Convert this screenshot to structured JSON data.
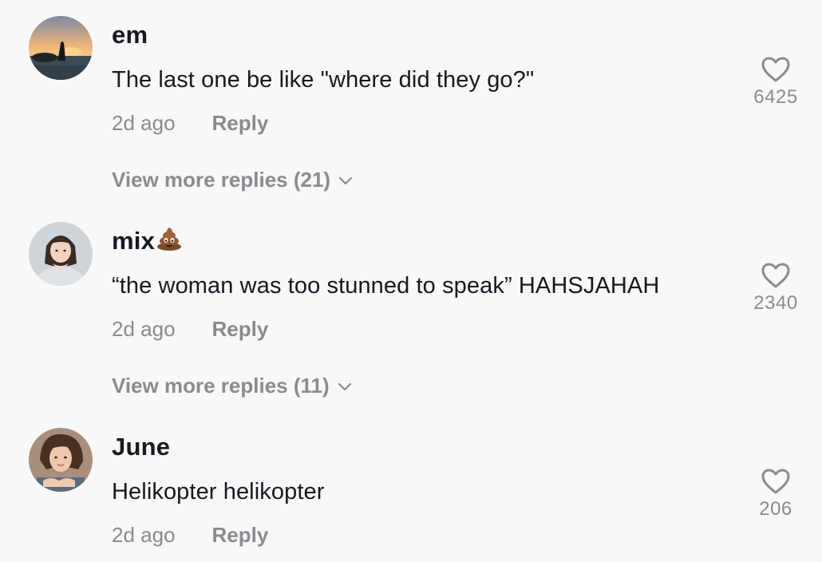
{
  "comments": [
    {
      "username": "em",
      "text": "The last one be like \"where did they go?\"",
      "time": "2d ago",
      "reply_label": "Reply",
      "likes": "6425",
      "more_replies": "View more replies (21)",
      "avatar": "sunset-silhouette-avatar"
    },
    {
      "username": "mix",
      "username_emoji": "poop-emoji",
      "text": "“the woman was too stunned to speak” HAHSJAHAH",
      "time": "2d ago",
      "reply_label": "Reply",
      "likes": "2340",
      "more_replies": "View more replies (11)",
      "avatar": "girl-heart-hands-avatar"
    },
    {
      "username": "June",
      "text": "Helikopter helikopter",
      "time": "2d ago",
      "reply_label": "Reply",
      "likes": "206",
      "avatar": "girl-portrait-avatar"
    }
  ],
  "icons": {
    "like": "heart-outline-icon",
    "expand": "chevron-down-icon"
  },
  "colors": {
    "background": "#f8f8f8",
    "primary_text": "#161823",
    "secondary_text": "#8a8b91"
  }
}
